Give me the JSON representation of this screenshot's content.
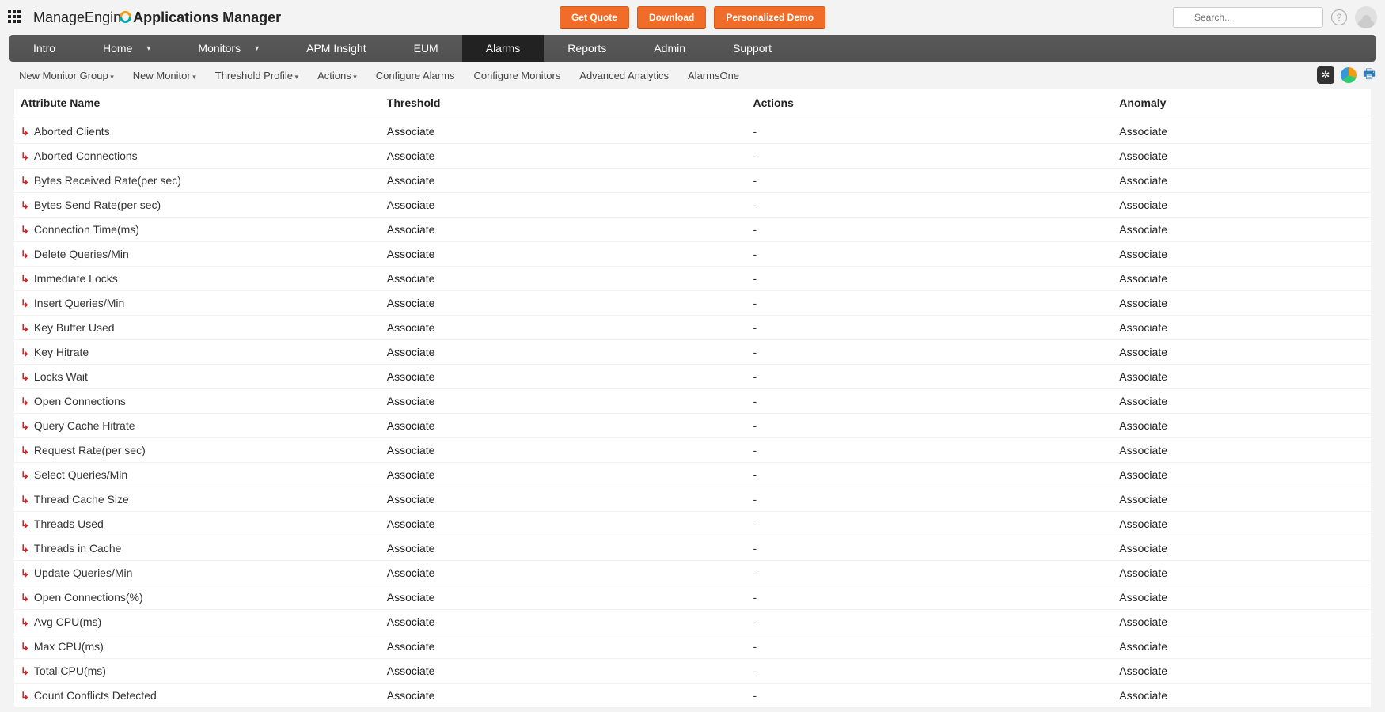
{
  "brand": {
    "prefix": "ManageEngin",
    "suffix_e": "e",
    "product": "Applications Manager"
  },
  "ctas": {
    "quote": "Get Quote",
    "download": "Download",
    "demo": "Personalized Demo"
  },
  "search": {
    "placeholder": "Search..."
  },
  "nav": {
    "intro": "Intro",
    "home": "Home",
    "monitors": "Monitors",
    "apm": "APM Insight",
    "eum": "EUM",
    "alarms": "Alarms",
    "reports": "Reports",
    "admin": "Admin",
    "support": "Support",
    "active": "alarms"
  },
  "subnav": {
    "new_monitor_group": "New Monitor Group",
    "new_monitor": "New Monitor",
    "threshold_profile": "Threshold Profile",
    "actions": "Actions",
    "configure_alarms": "Configure Alarms",
    "configure_monitors": "Configure Monitors",
    "advanced_analytics": "Advanced Analytics",
    "alarms_one": "AlarmsOne"
  },
  "columns": {
    "name": "Attribute Name",
    "threshold": "Threshold",
    "actions": "Actions",
    "anomaly": "Anomaly"
  },
  "link_label": "Associate",
  "actions_placeholder": "-",
  "rows": [
    {
      "name": "Aborted Clients"
    },
    {
      "name": "Aborted Connections"
    },
    {
      "name": "Bytes Received Rate(per sec)"
    },
    {
      "name": "Bytes Send Rate(per sec)"
    },
    {
      "name": "Connection Time(ms)"
    },
    {
      "name": "Delete Queries/Min"
    },
    {
      "name": "Immediate Locks"
    },
    {
      "name": "Insert Queries/Min"
    },
    {
      "name": "Key Buffer Used"
    },
    {
      "name": "Key Hitrate"
    },
    {
      "name": "Locks Wait"
    },
    {
      "name": "Open Connections"
    },
    {
      "name": "Query Cache Hitrate"
    },
    {
      "name": "Request Rate(per sec)"
    },
    {
      "name": "Select Queries/Min"
    },
    {
      "name": "Thread Cache Size"
    },
    {
      "name": "Threads Used"
    },
    {
      "name": "Threads in Cache"
    },
    {
      "name": "Update Queries/Min"
    },
    {
      "name": "Open Connections(%)"
    },
    {
      "name": "Avg CPU(ms)"
    },
    {
      "name": "Max CPU(ms)"
    },
    {
      "name": "Total CPU(ms)"
    },
    {
      "name": "Count Conflicts Detected"
    }
  ]
}
